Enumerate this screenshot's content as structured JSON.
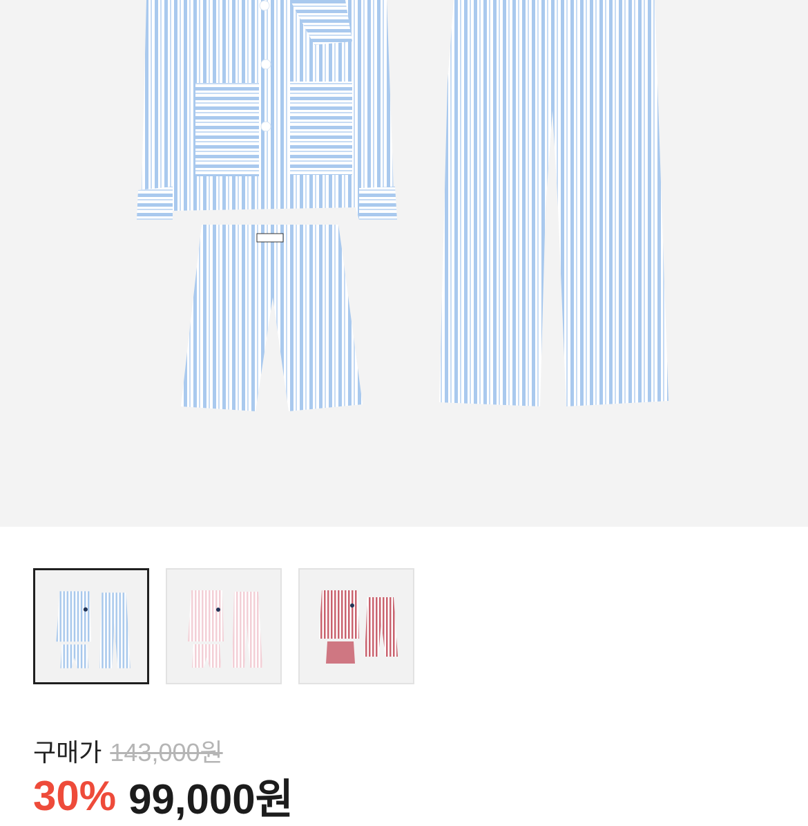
{
  "product": {
    "image_alt": "striped pajama set",
    "colors": {
      "blue": "#a8c8ec",
      "pink": "#f3cfd6",
      "red": "#c9626e",
      "background": "#f3f3f3"
    }
  },
  "thumbnails": [
    {
      "variant": "blue",
      "selected": true
    },
    {
      "variant": "pink",
      "selected": false
    },
    {
      "variant": "red",
      "selected": false
    }
  ],
  "pricing": {
    "label": "구매가",
    "original_price": "143,000원",
    "discount": "30%",
    "sale_price": "99,000원",
    "discount_color": "#ee4b3a"
  }
}
